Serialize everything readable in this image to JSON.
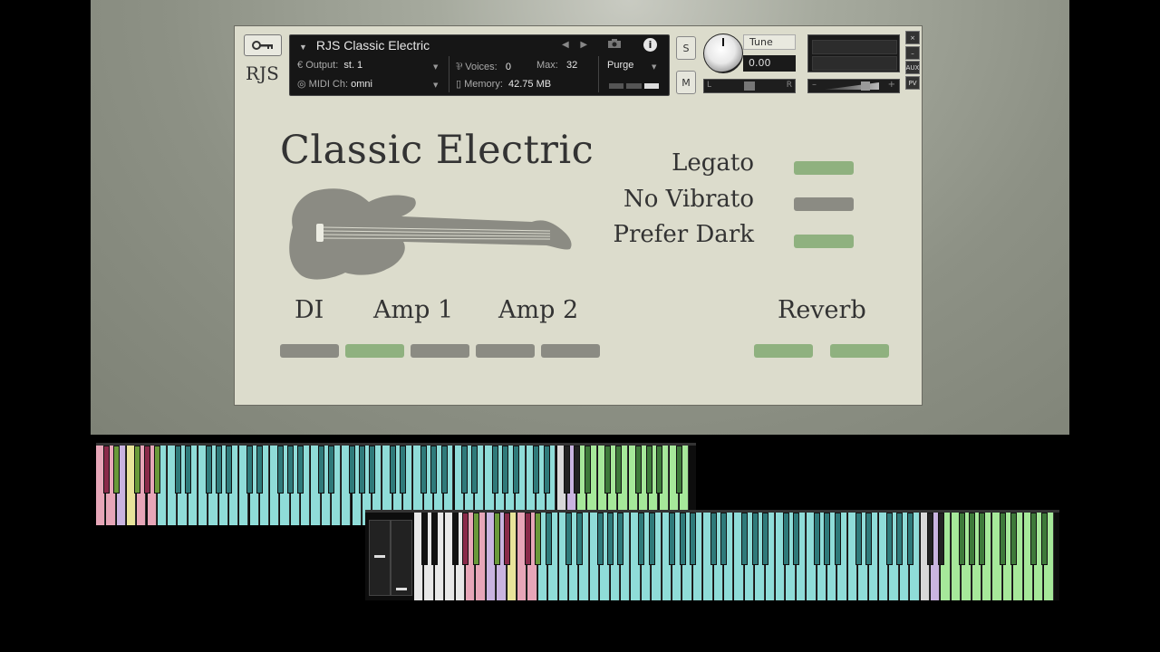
{
  "header": {
    "brand": "RJS",
    "instrument_name": "RJS Classic Electric",
    "output_label": "Output:",
    "output_value": "st. 1",
    "voices_label": "Voices:",
    "voices_value": "0",
    "max_label": "Max:",
    "max_value": "32",
    "purge_label": "Purge",
    "midi_label": "MIDI Ch:",
    "midi_value": "omni",
    "memory_label": "Memory:",
    "memory_value": "42.75 MB",
    "solo_label": "S",
    "mute_label": "M",
    "tune_label": "Tune",
    "tune_value": "0.00",
    "close_label": "×",
    "aux_label": "AUX",
    "pv_label": "PV",
    "minus_label": "–",
    "pan_left": "L",
    "pan_right": "R",
    "vol_minus": "–",
    "vol_plus": "+"
  },
  "main": {
    "title": "Classic Electric",
    "options": [
      {
        "label": "Legato",
        "state": "on"
      },
      {
        "label": "No Vibrato",
        "state": "off"
      },
      {
        "label": "Prefer Dark",
        "state": "on"
      }
    ],
    "sections": {
      "di": "DI",
      "amp1": "Amp 1",
      "amp2": "Amp 2",
      "reverb": "Reverb"
    },
    "mic_buttons": [
      {
        "name": "di",
        "state": "off"
      },
      {
        "name": "amp1-a",
        "state": "on"
      },
      {
        "name": "amp1-b",
        "state": "off"
      },
      {
        "name": "amp2-a",
        "state": "off"
      },
      {
        "name": "amp2-b",
        "state": "off"
      }
    ],
    "reverb_buttons": [
      {
        "name": "reverb-a",
        "state": "on"
      },
      {
        "name": "reverb-b",
        "state": "on"
      }
    ]
  },
  "colors": {
    "panel": "#dcdccc",
    "toggle_on": "#8fb17f",
    "toggle_off": "#8b8b83",
    "key_cyan": "#8fdcd8",
    "key_green": "#a6e89a",
    "key_pink": "#e7a6b8",
    "key_lavender": "#c9b4e0",
    "key_yellow": "#e8e49a"
  }
}
